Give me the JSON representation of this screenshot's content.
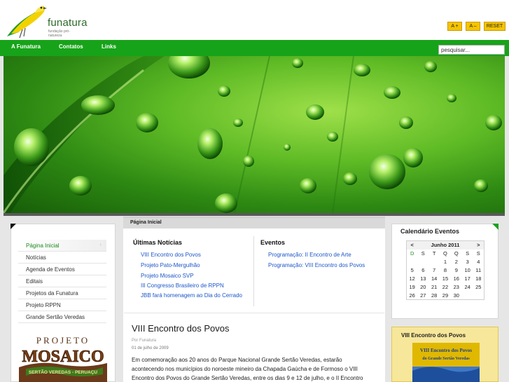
{
  "header": {
    "logo_word": "funatura",
    "logo_sub": "fundação pró-natureza",
    "font_increase": "A +",
    "font_decrease": "A –",
    "font_reset": "RESET"
  },
  "nav": {
    "items": [
      "A Funatura",
      "Contatos",
      "Links"
    ],
    "search_placeholder": "pesquisar..."
  },
  "sidebar": {
    "items": [
      {
        "label": "Página Inicial",
        "active": true
      },
      {
        "label": "Notícias"
      },
      {
        "label": "Agenda de Eventos"
      },
      {
        "label": "Editais"
      },
      {
        "label": "Projetos da Funatura"
      },
      {
        "label": "Projeto RPPN"
      },
      {
        "label": "Grande Sertão Veredas"
      }
    ],
    "banner_top": "PROJETO",
    "banner_main": "MOSAICO",
    "banner_bottom": "SERTÃO VEREDAS - PERUAÇU"
  },
  "center": {
    "breadcrumb": "Página Inicial",
    "news_title": "Últimas Notícias",
    "news": [
      "VIII Encontro dos Povos",
      "Projeto Pato-Mergulhão",
      "Projeto Mosaico SVP",
      "III Congresso Brasileiro de RPPN",
      "JBB fará homenagem ao Dia do Cerrado"
    ],
    "events_title": "Eventos",
    "events": [
      "Programação: II Encontro de Arte",
      "Programação: VIII Encontro dos Povos"
    ],
    "article": {
      "title": "VIII Encontro dos Povos",
      "author": "Por Funatura",
      "date": "01 de julho de 2009",
      "lines": [
        "Em comemoração aos 20 anos do Parque Nacional Grande Sertão Veredas, estarão",
        "acontecendo nos municípios do noroeste mineiro da Chapada Gaúcha e de Formoso o VIII",
        "Encontro dos Povos do Grande Sertão Veredas, entre os dias 9 e 12 de julho, e o II Encontro"
      ]
    }
  },
  "calendar": {
    "title": "Calendário Eventos",
    "prev": "<",
    "month": "Junho 2011",
    "next": ">",
    "weekdays": [
      "D",
      "S",
      "T",
      "Q",
      "Q",
      "S",
      "S"
    ],
    "weeks": [
      [
        "",
        "",
        "",
        "1",
        "2",
        "3",
        "4"
      ],
      [
        "5",
        "6",
        "7",
        "8",
        "9",
        "10",
        "11"
      ],
      [
        "12",
        "13",
        "14",
        "15",
        "16",
        "17",
        "18"
      ],
      [
        "19",
        "20",
        "21",
        "22",
        "23",
        "24",
        "25"
      ],
      [
        "26",
        "27",
        "28",
        "29",
        "30",
        "",
        ""
      ]
    ]
  },
  "event_box": {
    "title": "VIII Encontro dos Povos",
    "poster_line1": "VIII Encontro dos Povos",
    "poster_line2": "do Grande Sertão Veredas"
  },
  "colors": {
    "nav_green": "#17a319",
    "link_blue": "#1d56c9",
    "button_yellow": "#f4c400"
  }
}
